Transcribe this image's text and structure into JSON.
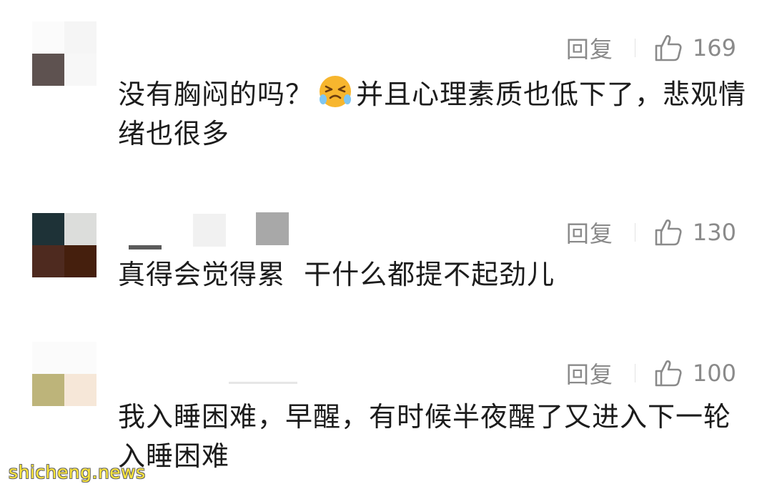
{
  "comments": [
    {
      "reply_label": "回复",
      "like_count": "169",
      "text_before_emoji": "没有胸闷的吗？",
      "emoji": "crying-laughing-face-icon",
      "text_after_emoji": "并且心理素质也低下了，悲观情绪也很多",
      "avatar_colors": [
        "#fbfbfb",
        "#f5f5f5",
        "#5e5250",
        "#f7f7f7"
      ]
    },
    {
      "reply_label": "回复",
      "like_count": "130",
      "text": "真得会觉得累  干什么都提不起劲儿",
      "avatar_colors": [
        "#1e3237",
        "#dcdddb",
        "#4e2a1f",
        "#451f0d"
      ]
    },
    {
      "reply_label": "回复",
      "like_count": "100",
      "text": "我入睡困难，早醒，有时候半夜醒了又进入下一轮入睡困难",
      "avatar_colors": [
        "#fbfbfb",
        "#fbfbfb",
        "#bdb47a",
        "#f6e7d8"
      ]
    }
  ],
  "watermark": "shicheng.news",
  "colors": {
    "text": "#1c1c1c",
    "meta": "#8a8a8a",
    "watermark": "#ffe83a"
  }
}
